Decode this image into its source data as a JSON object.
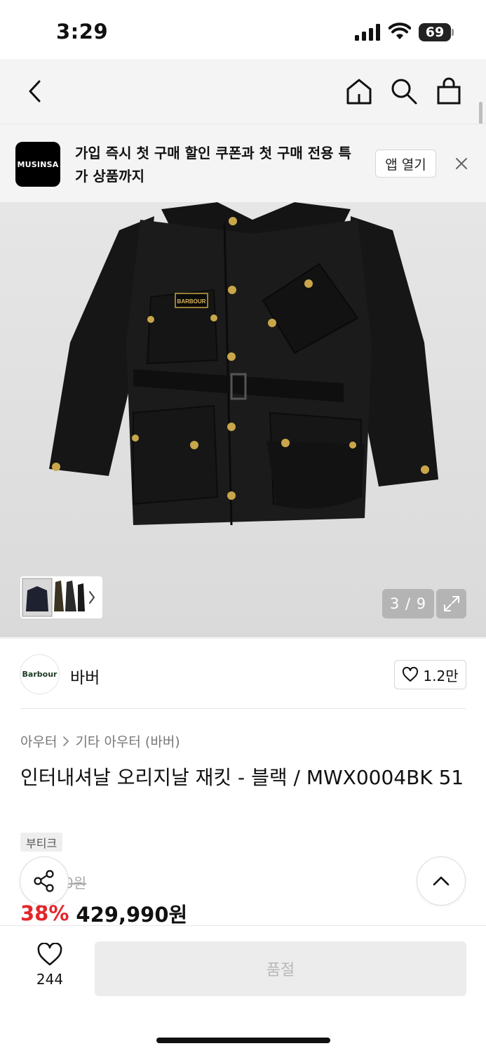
{
  "status_bar": {
    "time": "3:29",
    "battery": "69"
  },
  "nav": {
    "back": "back-arrow-icon",
    "home": "home-icon",
    "search": "search-icon",
    "cart": "shopping-bag-icon"
  },
  "promo": {
    "logo_text": "MUSINSA",
    "message": "가입 즉시 첫 구매 할인 쿠폰과 첫 구매 전용 특가 상품까지",
    "open_label": "앱 열기"
  },
  "gallery": {
    "counter": "3 / 9",
    "total_images": 9,
    "current_image": 3
  },
  "brand": {
    "logo_text": "Barbour",
    "name": "바버",
    "likes": "1.2만"
  },
  "breadcrumb": {
    "category": "아우터",
    "subcategory": "기타 아우터 (바버)"
  },
  "product": {
    "title": "인터내셔날 오리지날 재킷 - 블랙 / MWX0004BK 51",
    "tag": "부티크",
    "original_price_visible": "0원",
    "discount": "38%",
    "sale_price": "429,990원"
  },
  "bottom": {
    "wish_count": "244",
    "soldout_label": "품절"
  },
  "colors": {
    "accent_red": "#e3262b",
    "soldout_bg": "#ececec",
    "counter_bg": "#b4b4b4"
  }
}
